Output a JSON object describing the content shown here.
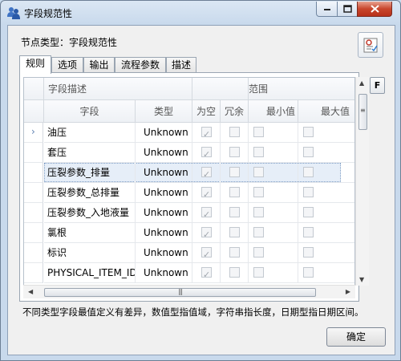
{
  "window": {
    "title": "字段规范性",
    "buttons": [
      "minimize",
      "maximize",
      "close"
    ]
  },
  "node_type_label": "节点类型：字段规范性",
  "tabs": [
    {
      "label": "规则",
      "active": true
    },
    {
      "label": "选项",
      "active": false
    },
    {
      "label": "输出",
      "active": false
    },
    {
      "label": "流程参数",
      "active": false
    },
    {
      "label": "描述",
      "active": false
    }
  ],
  "side_button": "F",
  "grid": {
    "group_headers": {
      "field_desc": "字段描述",
      "range": "范围"
    },
    "columns": {
      "field": "字段",
      "type": "类型",
      "nullable": "为空",
      "redundant": "冗余",
      "min": "最小值",
      "max": "最大值"
    },
    "rows": [
      {
        "field": "油压",
        "type": "Unknown",
        "nullable": true,
        "current": true,
        "selected": false
      },
      {
        "field": "套压",
        "type": "Unknown",
        "nullable": true,
        "current": false,
        "selected": false
      },
      {
        "field": "压裂参数_排量",
        "type": "Unknown",
        "nullable": true,
        "current": false,
        "selected": true
      },
      {
        "field": "压裂参数_总排量",
        "type": "Unknown",
        "nullable": true,
        "current": false,
        "selected": false
      },
      {
        "field": "压裂参数_入地液量",
        "type": "Unknown",
        "nullable": true,
        "current": false,
        "selected": false
      },
      {
        "field": "氯根",
        "type": "Unknown",
        "nullable": true,
        "current": false,
        "selected": false
      },
      {
        "field": "标识",
        "type": "Unknown",
        "nullable": true,
        "current": false,
        "selected": false
      },
      {
        "field": "PHYSICAL_ITEM_ID",
        "type": "Unknown",
        "nullable": true,
        "current": false,
        "selected": false
      }
    ]
  },
  "note": "不同类型字段最值定义有差异，数值型指值域，字符串指长度，日期型指日期区间。",
  "ok_label": "确定"
}
